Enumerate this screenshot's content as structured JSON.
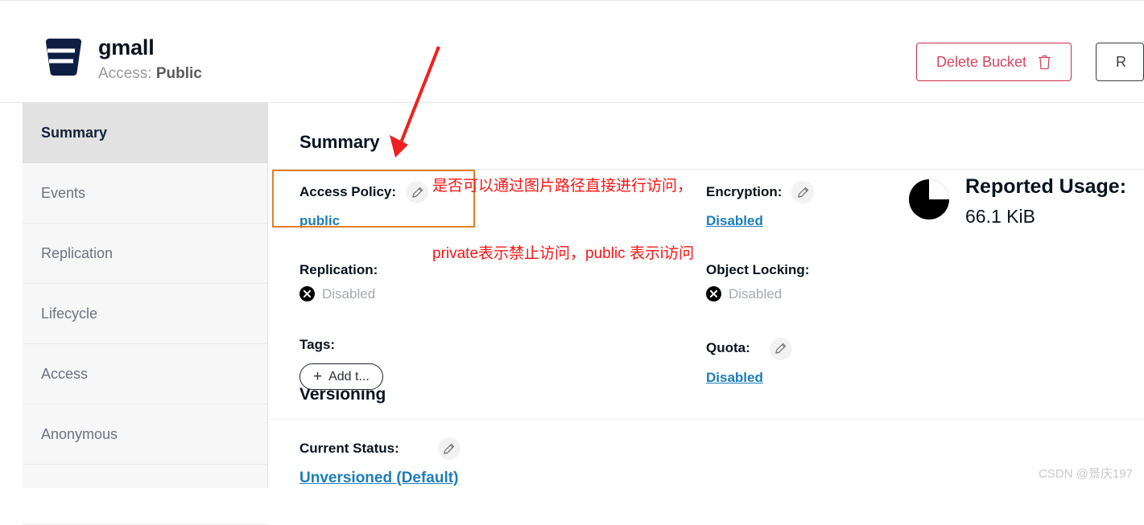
{
  "header": {
    "bucket_icon": "bucket-icon",
    "bucket_name": "gmall",
    "access_prefix": "Access: ",
    "access_value": "Public",
    "delete_button": "Delete Bucket",
    "delete_icon": "trash-icon",
    "secondary_button": "R"
  },
  "sidebar": {
    "items": [
      {
        "label": "Summary",
        "active": true
      },
      {
        "label": "Events",
        "active": false
      },
      {
        "label": "Replication",
        "active": false
      },
      {
        "label": "Lifecycle",
        "active": false
      },
      {
        "label": "Access",
        "active": false
      },
      {
        "label": "Anonymous",
        "active": false
      }
    ]
  },
  "main": {
    "summary_title": "Summary",
    "versioning_title": "Versioning",
    "fields": {
      "access_policy": {
        "label": "Access Policy:",
        "value": "public",
        "edit_icon": "pencil-icon"
      },
      "replication": {
        "label": "Replication:",
        "value": "Disabled",
        "status_icon": "x-circle-icon"
      },
      "tags": {
        "label": "Tags:",
        "add_button": "Add t...",
        "add_icon": "plus-icon"
      },
      "encryption": {
        "label": "Encryption:",
        "value": "Disabled",
        "edit_icon": "pencil-icon"
      },
      "object_locking": {
        "label": "Object Locking:",
        "value": "Disabled",
        "status_icon": "x-circle-icon"
      },
      "quota": {
        "label": "Quota:",
        "value": "Disabled",
        "edit_icon": "pencil-icon"
      },
      "reported_usage": {
        "label": "Reported Usage:",
        "value": "66.1 KiB",
        "icon": "pie-chart-icon"
      },
      "current_status": {
        "label": "Current Status:",
        "value": "Unversioned (Default)",
        "edit_icon": "pencil-icon"
      }
    }
  },
  "annotations": {
    "note_line1": "是否可以通过图片路径直接进行访问，",
    "note_line2": "private表示禁止访问，public 表示i访问",
    "arrow": "red-arrow",
    "highlight": "orange-highlight-box"
  },
  "watermark": "CSDN @景庆197",
  "colors": {
    "link": "#1d7dbb",
    "danger": "#d6455f",
    "brand_navy": "#0f1f44",
    "annotation_red": "#fc1414",
    "highlight_orange": "#e08020",
    "sidebar_bg": "#f7f7f7",
    "sidebar_active_bg": "#e2e2e2"
  }
}
